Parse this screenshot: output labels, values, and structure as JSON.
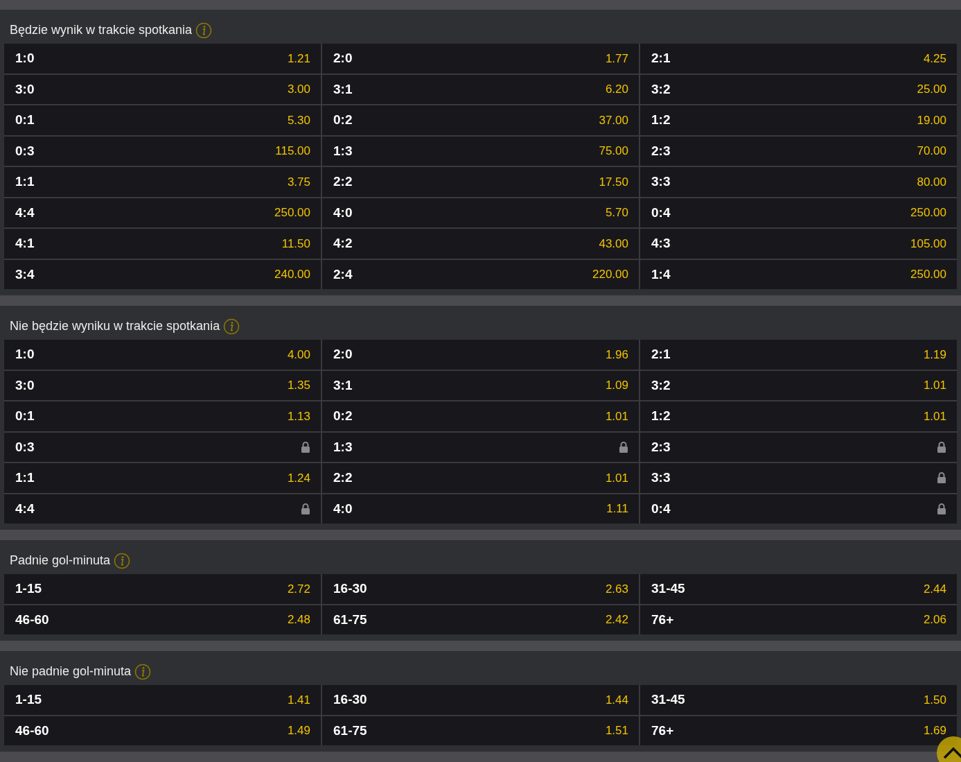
{
  "sections": [
    {
      "title": "Będzie wynik w trakcie spotkania",
      "rows": [
        [
          {
            "label": "1:0",
            "odds": "1.21",
            "locked": false
          },
          {
            "label": "2:0",
            "odds": "1.77",
            "locked": false
          },
          {
            "label": "2:1",
            "odds": "4.25",
            "locked": false
          }
        ],
        [
          {
            "label": "3:0",
            "odds": "3.00",
            "locked": false
          },
          {
            "label": "3:1",
            "odds": "6.20",
            "locked": false
          },
          {
            "label": "3:2",
            "odds": "25.00",
            "locked": false
          }
        ],
        [
          {
            "label": "0:1",
            "odds": "5.30",
            "locked": false
          },
          {
            "label": "0:2",
            "odds": "37.00",
            "locked": false
          },
          {
            "label": "1:2",
            "odds": "19.00",
            "locked": false
          }
        ],
        [
          {
            "label": "0:3",
            "odds": "115.00",
            "locked": false
          },
          {
            "label": "1:3",
            "odds": "75.00",
            "locked": false
          },
          {
            "label": "2:3",
            "odds": "70.00",
            "locked": false
          }
        ],
        [
          {
            "label": "1:1",
            "odds": "3.75",
            "locked": false
          },
          {
            "label": "2:2",
            "odds": "17.50",
            "locked": false
          },
          {
            "label": "3:3",
            "odds": "80.00",
            "locked": false
          }
        ],
        [
          {
            "label": "4:4",
            "odds": "250.00",
            "locked": false
          },
          {
            "label": "4:0",
            "odds": "5.70",
            "locked": false
          },
          {
            "label": "0:4",
            "odds": "250.00",
            "locked": false
          }
        ],
        [
          {
            "label": "4:1",
            "odds": "11.50",
            "locked": false
          },
          {
            "label": "4:2",
            "odds": "43.00",
            "locked": false
          },
          {
            "label": "4:3",
            "odds": "105.00",
            "locked": false
          }
        ],
        [
          {
            "label": "3:4",
            "odds": "240.00",
            "locked": false
          },
          {
            "label": "2:4",
            "odds": "220.00",
            "locked": false
          },
          {
            "label": "1:4",
            "odds": "250.00",
            "locked": false
          }
        ]
      ]
    },
    {
      "title": "Nie będzie wyniku w trakcie spotkania",
      "rows": [
        [
          {
            "label": "1:0",
            "odds": "4.00",
            "locked": false
          },
          {
            "label": "2:0",
            "odds": "1.96",
            "locked": false
          },
          {
            "label": "2:1",
            "odds": "1.19",
            "locked": false
          }
        ],
        [
          {
            "label": "3:0",
            "odds": "1.35",
            "locked": false
          },
          {
            "label": "3:1",
            "odds": "1.09",
            "locked": false
          },
          {
            "label": "3:2",
            "odds": "1.01",
            "locked": false
          }
        ],
        [
          {
            "label": "0:1",
            "odds": "1.13",
            "locked": false
          },
          {
            "label": "0:2",
            "odds": "1.01",
            "locked": false
          },
          {
            "label": "1:2",
            "odds": "1.01",
            "locked": false
          }
        ],
        [
          {
            "label": "0:3",
            "locked": true
          },
          {
            "label": "1:3",
            "locked": true
          },
          {
            "label": "2:3",
            "locked": true
          }
        ],
        [
          {
            "label": "1:1",
            "odds": "1.24",
            "locked": false
          },
          {
            "label": "2:2",
            "odds": "1.01",
            "locked": false
          },
          {
            "label": "3:3",
            "locked": true
          }
        ],
        [
          {
            "label": "4:4",
            "locked": true
          },
          {
            "label": "4:0",
            "odds": "1.11",
            "locked": false
          },
          {
            "label": "0:4",
            "locked": true
          }
        ]
      ]
    },
    {
      "title": "Padnie gol-minuta",
      "rows": [
        [
          {
            "label": "1-15",
            "odds": "2.72",
            "locked": false
          },
          {
            "label": "16-30",
            "odds": "2.63",
            "locked": false
          },
          {
            "label": "31-45",
            "odds": "2.44",
            "locked": false
          }
        ],
        [
          {
            "label": "46-60",
            "odds": "2.48",
            "locked": false
          },
          {
            "label": "61-75",
            "odds": "2.42",
            "locked": false
          },
          {
            "label": "76+",
            "odds": "2.06",
            "locked": false
          }
        ]
      ]
    },
    {
      "title": "Nie padnie gol-minuta",
      "rows": [
        [
          {
            "label": "1-15",
            "odds": "1.41",
            "locked": false
          },
          {
            "label": "16-30",
            "odds": "1.44",
            "locked": false
          },
          {
            "label": "31-45",
            "odds": "1.50",
            "locked": false
          }
        ],
        [
          {
            "label": "46-60",
            "odds": "1.49",
            "locked": false
          },
          {
            "label": "61-75",
            "odds": "1.51",
            "locked": false
          },
          {
            "label": "76+",
            "odds": "1.69",
            "locked": false
          }
        ]
      ]
    }
  ]
}
